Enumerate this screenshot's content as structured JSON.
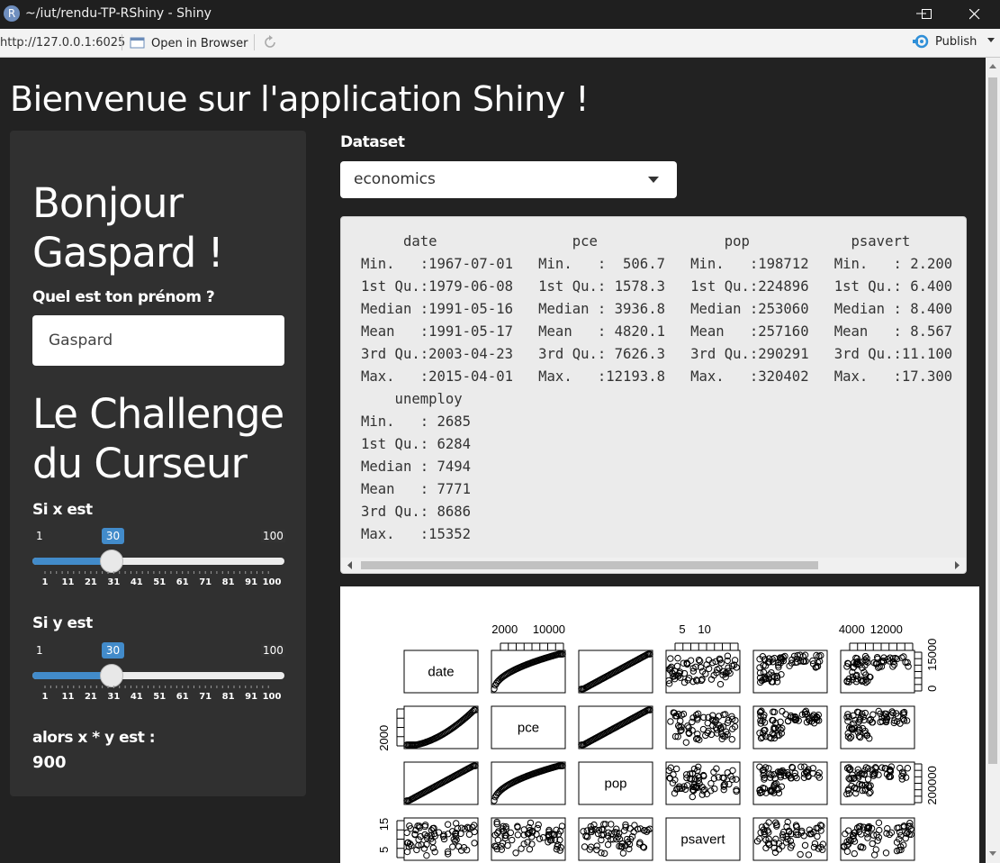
{
  "window": {
    "title": "~/iut/rendu-TP-RShiny - Shiny",
    "logo_letter": "R"
  },
  "toolbar": {
    "url": "http://127.0.0.1:6025",
    "open_in_browser": "Open in Browser",
    "publish": "Publish"
  },
  "app": {
    "title": "Bienvenue sur l'application Shiny !",
    "greeting": "Bonjour Gaspard !",
    "name_label": "Quel est ton prénom ?",
    "name_value": "Gaspard",
    "challenge_title": "Le Challenge du Curseur",
    "slider_x": {
      "label": "Si x est",
      "min": 1,
      "max": 100,
      "value": 30,
      "ticks": [
        "1",
        "11",
        "21",
        "31",
        "41",
        "51",
        "61",
        "71",
        "81",
        "91",
        "100"
      ]
    },
    "slider_y": {
      "label": "Si y est",
      "min": 1,
      "max": 100,
      "value": 30,
      "ticks": [
        "1",
        "11",
        "21",
        "31",
        "41",
        "51",
        "61",
        "71",
        "81",
        "91",
        "100"
      ]
    },
    "result_label": "alors x * y est :",
    "result_value": "900",
    "dataset_label": "Dataset",
    "dataset_value": "economics",
    "summary": {
      "lines": [
        "     date                pce               pop            psavert     ",
        "Min.   :1967-07-01   Min.   :  506.7   Min.   :198712   Min.   : 2.200",
        "1st Qu.:1979-06-08   1st Qu.: 1578.3   1st Qu.:224896   1st Qu.: 6.400",
        "Median :1991-05-16   Median : 3936.8   Median :253060   Median : 8.400",
        "Mean   :1991-05-17   Mean   : 4820.1   Mean   :257160   Mean   : 8.567",
        "3rd Qu.:2003-04-23   3rd Qu.: 7626.3   3rd Qu.:290291   3rd Qu.:11.100",
        "Max.   :2015-04-01   Max.   :12193.8   Max.   :320402   Max.   :17.300",
        "    unemploy    ",
        "Min.   : 2685  ",
        "1st Qu.: 6284  ",
        "Median : 7494  ",
        "Mean   : 7771  ",
        "3rd Qu.: 8686  ",
        "Max.   :15352  "
      ]
    },
    "plot": {
      "variables": [
        "date",
        "pce",
        "pop",
        "psavert"
      ],
      "top_axis_labels": [
        [
          "2000",
          "10000"
        ],
        [
          "5",
          "10"
        ],
        [
          "4000",
          "12000"
        ]
      ],
      "right_axis_labels": [
        [
          "0",
          "15000"
        ],
        [
          "200000"
        ]
      ],
      "left_axis_labels": [
        [
          "2000"
        ],
        [
          "5",
          "15"
        ]
      ]
    }
  },
  "colors": {
    "background": "#222222",
    "panel": "#303030",
    "accent": "#428bca"
  }
}
